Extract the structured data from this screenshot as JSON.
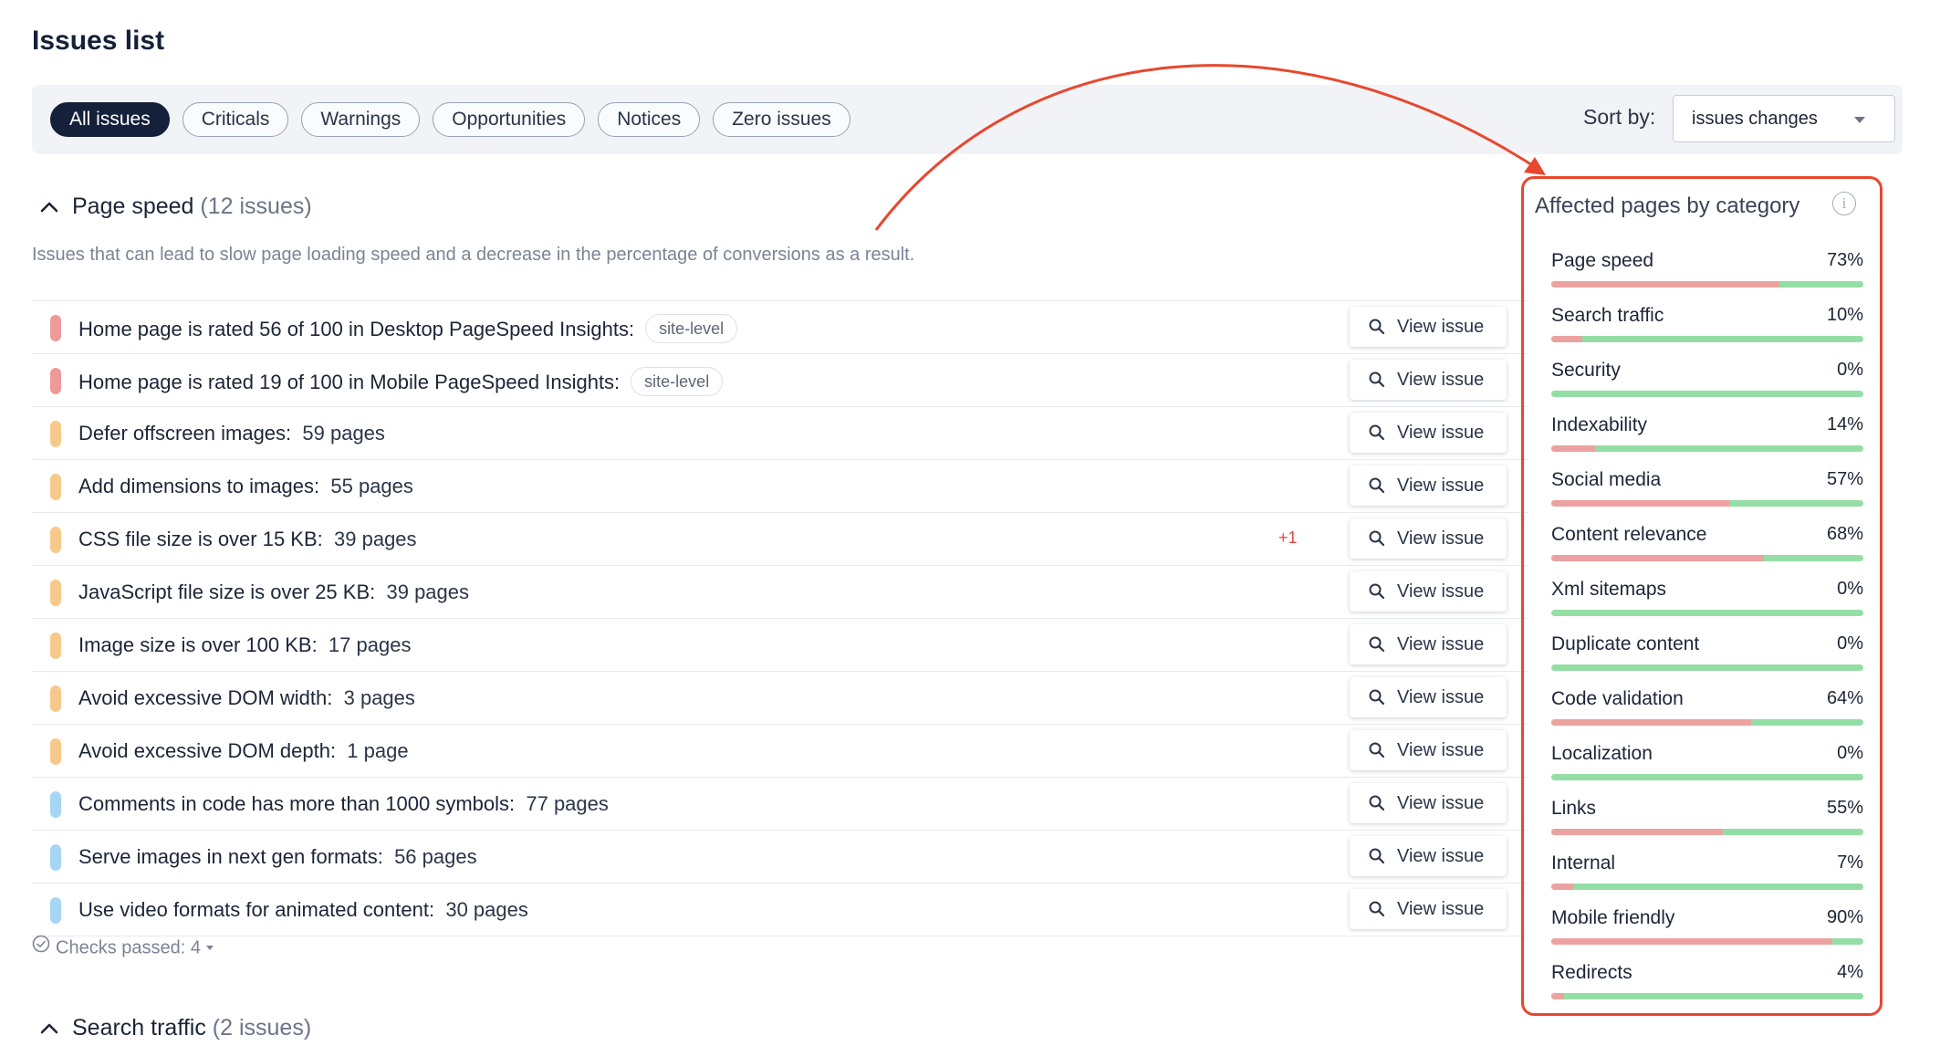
{
  "title": "Issues list",
  "filters": [
    {
      "label": "All issues",
      "active": true
    },
    {
      "label": "Criticals",
      "active": false
    },
    {
      "label": "Warnings",
      "active": false
    },
    {
      "label": "Opportunities",
      "active": false
    },
    {
      "label": "Notices",
      "active": false
    },
    {
      "label": "Zero issues",
      "active": false
    }
  ],
  "sort": {
    "label": "Sort by:",
    "value": "issues changes"
  },
  "section": {
    "name": "Page speed",
    "count": "(12 issues)",
    "description": "Issues that can lead to slow page loading speed and a decrease in the percentage of conversions as a result."
  },
  "severity_colors": {
    "critical": "#ee9a9a",
    "warning": "#f6c98b",
    "notice": "#a6d6f4"
  },
  "issues": [
    {
      "text": "Home page is rated 56 of 100 in Desktop PageSpeed Insights:",
      "pages": "",
      "tag": "site-level",
      "severity": "critical",
      "change": ""
    },
    {
      "text": "Home page is rated 19 of 100 in Mobile PageSpeed Insights:",
      "pages": "",
      "tag": "site-level",
      "severity": "critical",
      "change": ""
    },
    {
      "text": "Defer offscreen images:",
      "pages": "59 pages",
      "tag": "",
      "severity": "warning",
      "change": ""
    },
    {
      "text": "Add dimensions to images:",
      "pages": "55 pages",
      "tag": "",
      "severity": "warning",
      "change": ""
    },
    {
      "text": "CSS file size is over 15 KB:",
      "pages": "39 pages",
      "tag": "",
      "severity": "warning",
      "change": "+1"
    },
    {
      "text": "JavaScript file size is over 25 KB:",
      "pages": "39 pages",
      "tag": "",
      "severity": "warning",
      "change": ""
    },
    {
      "text": "Image size is over 100 KB:",
      "pages": "17 pages",
      "tag": "",
      "severity": "warning",
      "change": ""
    },
    {
      "text": "Avoid excessive DOM width:",
      "pages": "3 pages",
      "tag": "",
      "severity": "warning",
      "change": ""
    },
    {
      "text": "Avoid excessive DOM depth:",
      "pages": "1 page",
      "tag": "",
      "severity": "warning",
      "change": ""
    },
    {
      "text": "Comments in code has more than 1000 symbols:",
      "pages": "77 pages",
      "tag": "",
      "severity": "notice",
      "change": ""
    },
    {
      "text": "Serve images in next gen formats:",
      "pages": "56 pages",
      "tag": "",
      "severity": "notice",
      "change": ""
    },
    {
      "text": "Use video formats for animated content:",
      "pages": "30 pages",
      "tag": "",
      "severity": "notice",
      "change": ""
    }
  ],
  "view_issue_label": "View issue",
  "checks_passed": "Checks passed: 4",
  "next_section": {
    "name": "Search traffic",
    "count": "(2 issues)"
  },
  "panel": {
    "title": "Affected pages by category",
    "info_icon": "info-icon",
    "accent_color": "#e8472f",
    "categories": [
      {
        "name": "Page speed",
        "percent": 73,
        "label": "73%"
      },
      {
        "name": "Search traffic",
        "percent": 10,
        "label": "10%"
      },
      {
        "name": "Security",
        "percent": 0,
        "label": "0%"
      },
      {
        "name": "Indexability",
        "percent": 14,
        "label": "14%"
      },
      {
        "name": "Social media",
        "percent": 57,
        "label": "57%"
      },
      {
        "name": "Content relevance",
        "percent": 68,
        "label": "68%"
      },
      {
        "name": "Xml sitemaps",
        "percent": 0,
        "label": "0%"
      },
      {
        "name": "Duplicate content",
        "percent": 0,
        "label": "0%"
      },
      {
        "name": "Code validation",
        "percent": 64,
        "label": "64%"
      },
      {
        "name": "Localization",
        "percent": 0,
        "label": "0%"
      },
      {
        "name": "Links",
        "percent": 55,
        "label": "55%"
      },
      {
        "name": "Internal",
        "percent": 7,
        "label": "7%"
      },
      {
        "name": "Mobile friendly",
        "percent": 90,
        "label": "90%"
      },
      {
        "name": "Redirects",
        "percent": 4,
        "label": "4%"
      }
    ]
  }
}
